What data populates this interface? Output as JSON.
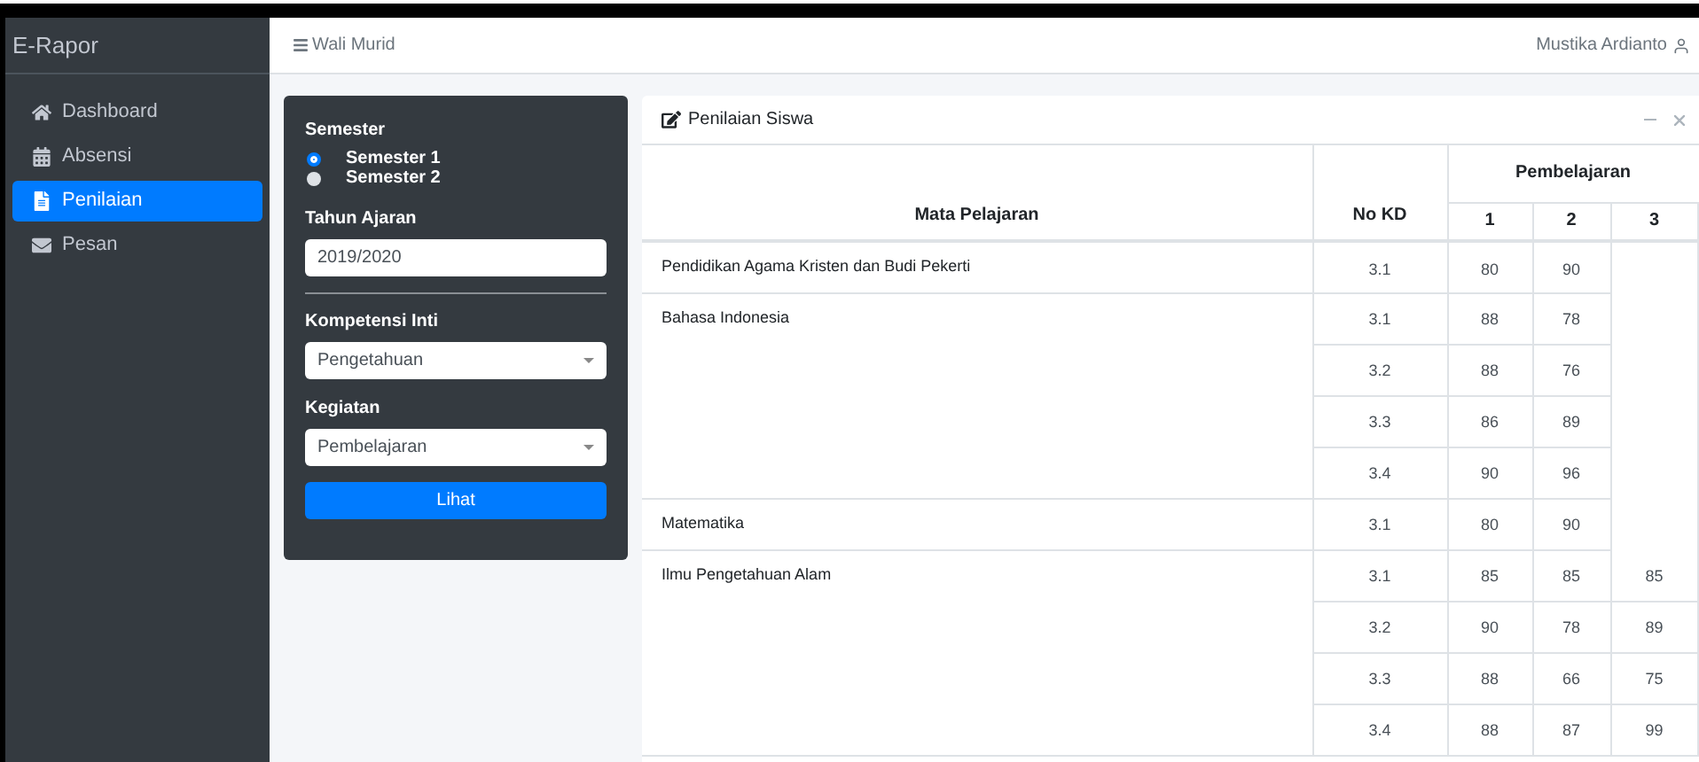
{
  "sidebar": {
    "brand": "E-Rapor",
    "items": [
      {
        "label": "Dashboard",
        "selected": false
      },
      {
        "label": "Absensi",
        "selected": false
      },
      {
        "label": "Penilaian",
        "selected": true
      },
      {
        "label": "Pesan",
        "selected": false
      }
    ]
  },
  "header": {
    "menu_label": "Wali Murid",
    "user": "Mustika Ardianto"
  },
  "filter": {
    "semester_label": "Semester",
    "semesters": [
      {
        "label": "Semester 1",
        "selected": true
      },
      {
        "label": "Semester 2",
        "selected": false
      }
    ],
    "year_label": "Tahun Ajaran",
    "year_value": "2019/2020",
    "competence_label": "Kompetensi Inti",
    "competence_value": "Pengetahuan",
    "activity_label": "Kegiatan",
    "activity_value": "Pembelajaran",
    "button": "Lihat"
  },
  "card": {
    "title": "Penilaian Siswa"
  },
  "table": {
    "columns": {
      "subject": "Mata Pelajaran",
      "kd": "No KD",
      "group": "Pembelajaran",
      "numbers": [
        "1",
        "2",
        "3"
      ]
    },
    "rows": [
      {
        "subject": "Pendidikan Agama Kristen dan Budi Pekerti",
        "kds": [
          {
            "kd": "3.1",
            "scores": [
              "80",
              "90"
            ]
          }
        ]
      },
      {
        "subject": "Bahasa Indonesia",
        "kds": [
          {
            "kd": "3.1",
            "scores": [
              "88",
              "78"
            ]
          },
          {
            "kd": "3.2",
            "scores": [
              "88",
              "76"
            ]
          },
          {
            "kd": "3.3",
            "scores": [
              "86",
              "89"
            ]
          },
          {
            "kd": "3.4",
            "scores": [
              "90",
              "96"
            ]
          }
        ]
      },
      {
        "subject": "Matematika",
        "kds": [
          {
            "kd": "3.1",
            "scores": [
              "80",
              "90"
            ]
          }
        ]
      },
      {
        "subject": "Ilmu Pengetahuan Alam",
        "kds": [
          {
            "kd": "3.1",
            "scores": [
              "85",
              "85",
              "85"
            ]
          },
          {
            "kd": "3.2",
            "scores": [
              "90",
              "78",
              "89"
            ]
          },
          {
            "kd": "3.3",
            "scores": [
              "88",
              "66",
              "75"
            ]
          },
          {
            "kd": "3.4",
            "scores": [
              "88",
              "87",
              "99"
            ]
          }
        ]
      }
    ]
  }
}
